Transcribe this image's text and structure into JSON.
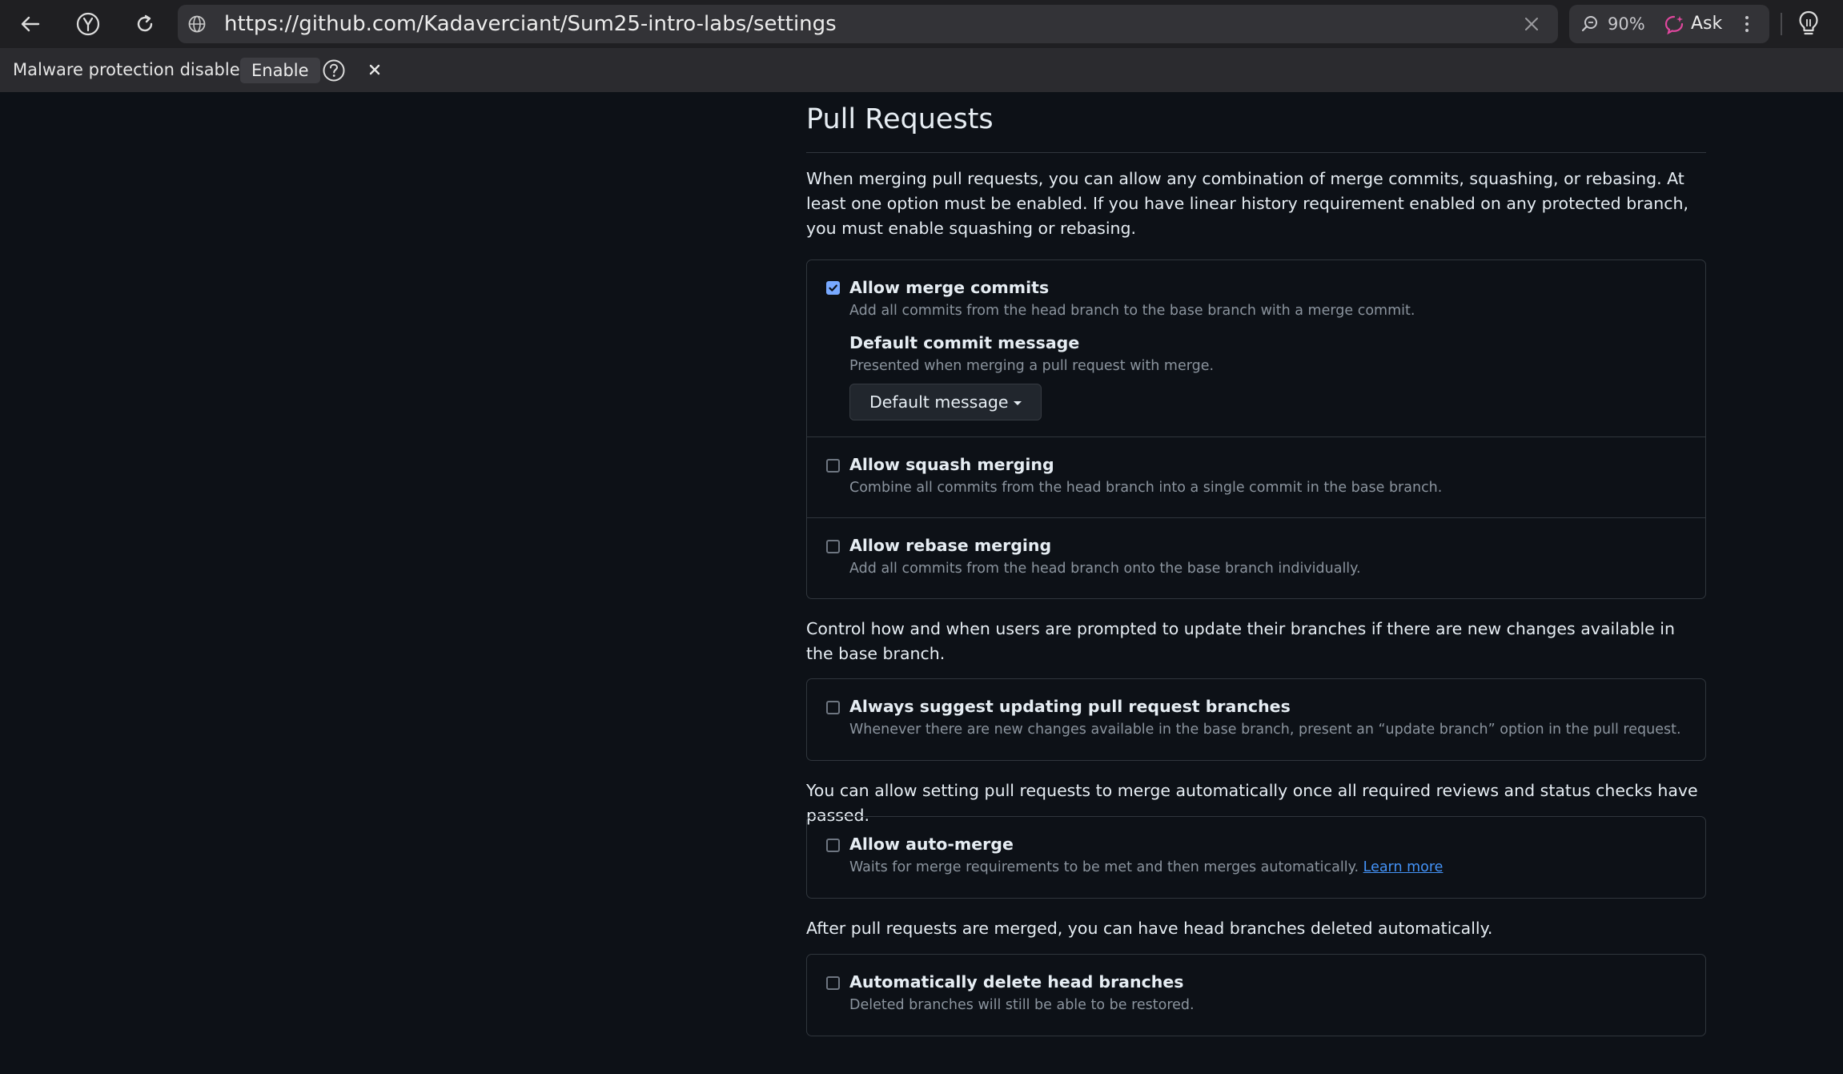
{
  "browser": {
    "url": "https://github.com/Kadaverciant/Sum25-intro-labs/settings",
    "zoom": "90%",
    "ask_label": "Ask"
  },
  "notice": {
    "text": "Malware protection disabled",
    "enable_label": "Enable"
  },
  "section": {
    "title": "Pull Requests",
    "merge_intro": "When merging pull requests, you can allow any combination of merge commits, squashing, or rebasing. At least one option must be enabled. If you have linear history requirement enabled on any protected branch, you must enable squashing or rebasing.",
    "merge_options": {
      "merge_commits": {
        "title": "Allow merge commits",
        "description": "Add all commits from the head branch to the base branch with a merge commit.",
        "checked": true,
        "default_message": {
          "title": "Default commit message",
          "description": "Presented when merging a pull request with merge.",
          "button_label": "Default message"
        }
      },
      "squash": {
        "title": "Allow squash merging",
        "description": "Combine all commits from the head branch into a single commit in the base branch.",
        "checked": false
      },
      "rebase": {
        "title": "Allow rebase merging",
        "description": "Add all commits from the head branch onto the base branch individually.",
        "checked": false
      }
    },
    "update_intro": "Control how and when users are prompted to update their branches if there are new changes available in the base branch.",
    "update_option": {
      "title": "Always suggest updating pull request branches",
      "description": "Whenever there are new changes available in the base branch, present an “update branch” option in the pull request.",
      "checked": false
    },
    "automerge_intro": "You can allow setting pull requests to merge automatically once all required reviews and status checks have passed.",
    "automerge_option": {
      "title": "Allow auto-merge",
      "description": "Waits for merge requirements to be met and then merges automatically.",
      "learn_more": "Learn more",
      "checked": false
    },
    "delete_intro": "After pull requests are merged, you can have head branches deleted automatically.",
    "delete_option": {
      "title": "Automatically delete head branches",
      "description": "Deleted branches will still be able to be restored.",
      "checked": false
    }
  },
  "colors": {
    "page_background": "#0d1117",
    "border": "#30363d",
    "checkbox_checked": "#78a9ff",
    "link": "#4493f8",
    "muted_text": "#8b949e",
    "ask_icon": "#e0479e"
  },
  "icons": [
    "back-arrow-icon",
    "yandex-icon",
    "reload-icon",
    "globe-icon",
    "clear-icon",
    "zoom-icon",
    "ask-ai-icon",
    "menu-dots-icon",
    "bulb-icon",
    "help-icon",
    "close-icon",
    "caret-down-icon",
    "checkmark-icon"
  ]
}
